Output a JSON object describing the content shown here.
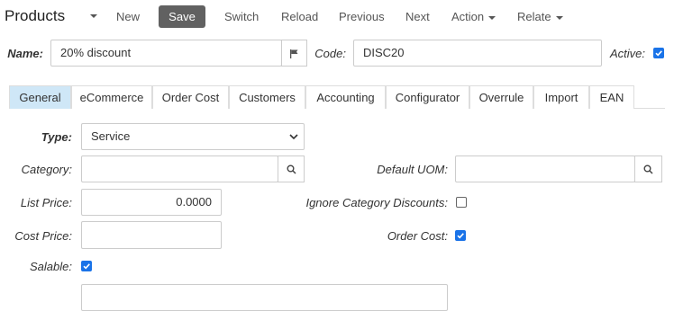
{
  "toolbar": {
    "title": "Products",
    "new": "New",
    "save": "Save",
    "switch": "Switch",
    "reload": "Reload",
    "previous": "Previous",
    "next": "Next",
    "action": "Action",
    "relate": "Relate"
  },
  "header": {
    "name_label": "Name:",
    "name_value": "20% discount",
    "code_label": "Code:",
    "code_value": "DISC20",
    "active_label": "Active:",
    "active_checked": true
  },
  "tabs": [
    "General",
    "eCommerce",
    "Order Cost",
    "Customers",
    "Accounting",
    "Configurator",
    "Overrule",
    "Import",
    "EAN"
  ],
  "form": {
    "type_label": "Type:",
    "type_value": "Service",
    "category_label": "Category:",
    "category_value": "",
    "default_uom_label": "Default UOM:",
    "default_uom_value": "",
    "list_price_label": "List Price:",
    "list_price_value": "0.0000",
    "ignore_cat_label": "Ignore Category Discounts:",
    "ignore_cat_checked": false,
    "cost_price_label": "Cost Price:",
    "cost_price_value": "",
    "order_cost_label": "Order Cost:",
    "order_cost_checked": true,
    "salable_label": "Salable:",
    "salable_checked": true
  },
  "colors": {
    "accent": "#1a73e8",
    "save_bg": "#616161",
    "active_tab_bg": "#cfe7f7"
  }
}
